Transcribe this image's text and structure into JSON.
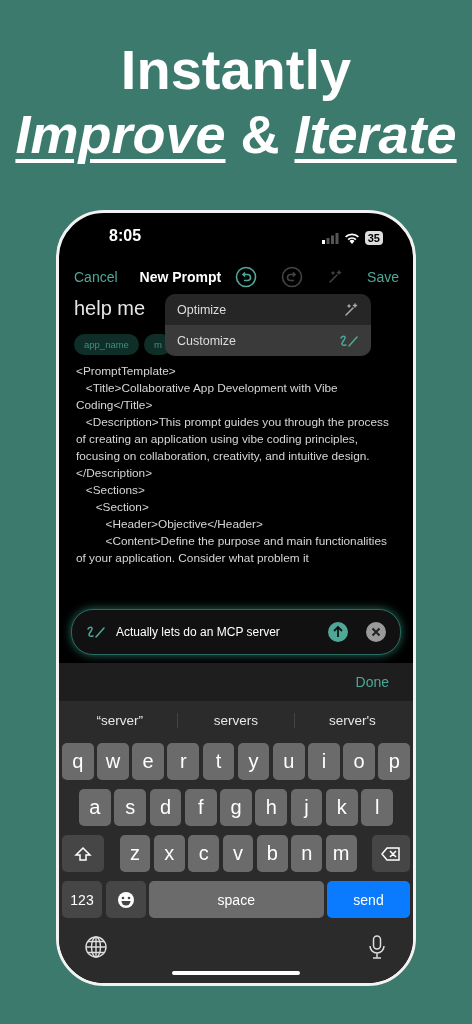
{
  "headline": {
    "line_1": "Instantly",
    "line_2": "*Improve* & *Iterate*"
  },
  "status_bar": {
    "time": "8:05",
    "battery": "35"
  },
  "nav": {
    "cancel": "Cancel",
    "title": "New Prompt",
    "save": "Save",
    "undo_disabled": false,
    "redo_disabled": true,
    "optimize_disabled": true
  },
  "prompt": {
    "title": "help me",
    "variables": [
      "app_name",
      "m"
    ],
    "body": "<PromptTemplate>\n   <Title>Collaborative App Development with Vibe Coding</Title>\n   <Description>This prompt guides you through the process of creating an application using vibe coding principles, focusing on collaboration, creativity, and intuitive design.</Description>\n   <Sections>\n      <Section>\n         <Header>Objective</Header>\n         <Content>Define the purpose and main functionalities of your application. Consider what problem it"
  },
  "menu": {
    "items": [
      {
        "label": "Optimize",
        "kind": "wand",
        "selected": false
      },
      {
        "label": "Customize",
        "kind": "pen",
        "selected": true
      }
    ]
  },
  "instruction": {
    "value": "Actually lets do an MCP server"
  },
  "accessory": {
    "done": "Done"
  },
  "suggestions": [
    "“server”",
    "servers",
    "server's"
  ],
  "keyboard": {
    "letter_rows": [
      [
        {
          "kind": "letter",
          "label": "q"
        },
        {
          "kind": "letter",
          "label": "w"
        },
        {
          "kind": "letter",
          "label": "e"
        },
        {
          "kind": "letter",
          "label": "r"
        },
        {
          "kind": "letter",
          "label": "t"
        },
        {
          "kind": "letter",
          "label": "y"
        },
        {
          "kind": "letter",
          "label": "u"
        },
        {
          "kind": "letter",
          "label": "i"
        },
        {
          "kind": "letter",
          "label": "o"
        },
        {
          "kind": "letter",
          "label": "p"
        }
      ],
      [
        {
          "kind": "letter",
          "label": "a"
        },
        {
          "kind": "letter",
          "label": "s"
        },
        {
          "kind": "letter",
          "label": "d"
        },
        {
          "kind": "letter",
          "label": "f"
        },
        {
          "kind": "letter",
          "label": "g"
        },
        {
          "kind": "letter",
          "label": "h"
        },
        {
          "kind": "letter",
          "label": "j"
        },
        {
          "kind": "letter",
          "label": "k"
        },
        {
          "kind": "letter",
          "label": "l"
        }
      ],
      [
        {
          "kind": "shift"
        },
        {
          "kind": "letter",
          "label": "z"
        },
        {
          "kind": "letter",
          "label": "x"
        },
        {
          "kind": "letter",
          "label": "c"
        },
        {
          "kind": "letter",
          "label": "v"
        },
        {
          "kind": "letter",
          "label": "b"
        },
        {
          "kind": "letter",
          "label": "n"
        },
        {
          "kind": "letter",
          "label": "m"
        },
        {
          "kind": "delete"
        }
      ]
    ],
    "function_row": [
      {
        "kind": "numbers",
        "label": "123"
      },
      {
        "kind": "emoji"
      },
      {
        "kind": "space",
        "label": "space"
      },
      {
        "kind": "send",
        "label": "send"
      }
    ]
  }
}
